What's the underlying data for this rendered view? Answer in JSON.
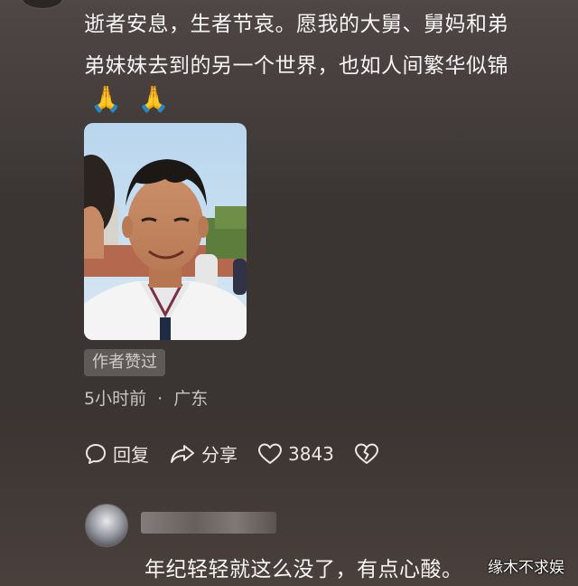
{
  "comment": {
    "lines": [
      "逝者安息，生者节哀。愿我的大舅、舅妈和弟",
      "弟妹妹去到的另一个世界，也如人间繁华似锦"
    ],
    "emojis": [
      "🙏",
      "🙏"
    ]
  },
  "author_liked_badge": "作者赞过",
  "meta": {
    "time": "5小时前",
    "separator": "·",
    "location": "广东"
  },
  "actions": {
    "reply_label": "回复",
    "share_label": "分享",
    "like_count": "3843"
  },
  "reply": {
    "text": "年纪轻轻就这么没了，有点心酸。"
  },
  "watermark": "缘木不求娱",
  "icons": {
    "reply": "reply-bubble-icon",
    "share": "share-arrow-icon",
    "like": "heart-icon",
    "dislike": "broken-heart-icon"
  }
}
